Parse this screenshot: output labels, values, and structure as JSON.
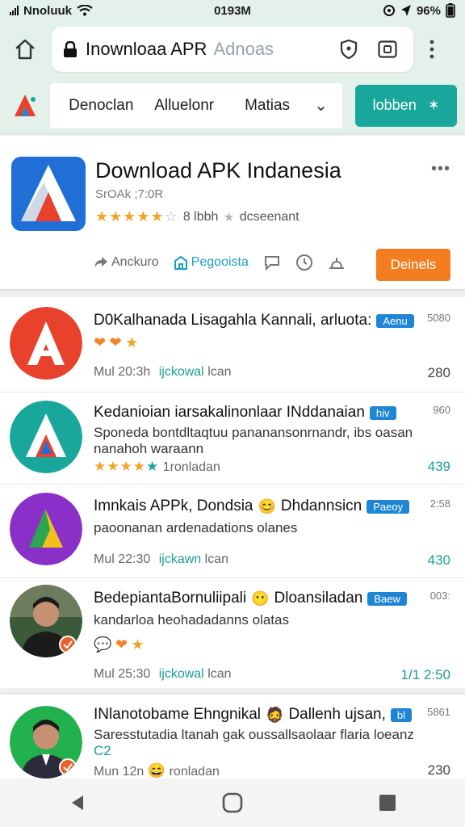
{
  "status_bar": {
    "carrier": "Nnoluuk",
    "time": "0193M",
    "battery": "96%"
  },
  "browser": {
    "url_text": "Inownloaa APR",
    "url_hint": "Adnoas",
    "home_icon": "home-icon",
    "lock_icon": "lock-icon"
  },
  "site_nav": {
    "items": [
      "Denoclan",
      "Alluelonr",
      "Matias"
    ],
    "chevron": "⌄",
    "cta_label": "lobben",
    "cta_icon": "✶"
  },
  "hero": {
    "title": "Download APK Indanesia",
    "subtitle": "SrOAk ;7:0R",
    "rating_stars": 4,
    "rating_text": "8 lbbh",
    "rating_extra": "dcseenant",
    "more": "•••",
    "actions": [
      "Anckuro",
      "Pegooista"
    ],
    "download_label": "Deinels"
  },
  "apps": [
    {
      "title": "D0Kalhanada  Lisagahla Kannali, arluota:",
      "badge": "Aenu",
      "version": "5080",
      "desc": "",
      "meta_time": "Mul 20:3h",
      "meta_link": "ijckowal",
      "meta_tail": "lcan",
      "count": "280",
      "count_teal": false,
      "icon_color": "#e8412c"
    },
    {
      "title": "Kedanioian iarsakalinonlaar INddanaian",
      "badge": "hiv",
      "version": "960",
      "desc": "Sponeda bontdltaqtuu pananansonrnandr, ibs oasan nanahoh waraann",
      "rating_text": "1ronladan",
      "count": "439",
      "count_teal": true,
      "icon_color": "#1aa79b"
    },
    {
      "title": "Imnkais APPk, Dondsia",
      "title_tail": "Dhdannsicn",
      "badge": "Paeoy",
      "version": "2:58",
      "desc": "paoonanan ardenadations olanes",
      "meta_time": "Mul 22:30",
      "meta_link": "ijckawn",
      "meta_tail": "lcan",
      "count": "430",
      "count_teal": true,
      "icon_color": "#8b2fc9"
    },
    {
      "title": "BedepiantaBornuliipali",
      "title_tail": "Dloansiladan",
      "badge": "Baew",
      "version": "003:",
      "desc": "kandarloa heohadadanns olatas",
      "meta_time": "Mul 25:30",
      "meta_link": "ijckowal",
      "meta_tail": "lcan",
      "count": "1/1 2:50",
      "count_teal": true,
      "icon_color": "#3a5a3a"
    }
  ],
  "featured": {
    "title": "INlanotobame Ehngnikal",
    "title_tail": "Dallenh ujsan,",
    "badge": "bl",
    "version": "5861",
    "desc": "Saresstutadia ltanah gak oussallsaolaar flaria loeanz",
    "desc_tail": "C2",
    "meta_time": "Mun 12n",
    "meta_tail": "ronladan",
    "count": "230"
  },
  "colors": {
    "accent": "#1aa79b",
    "download": "#f47d20",
    "badge": "#1f86d6",
    "toolbar_bg": "#e3f1ea"
  }
}
